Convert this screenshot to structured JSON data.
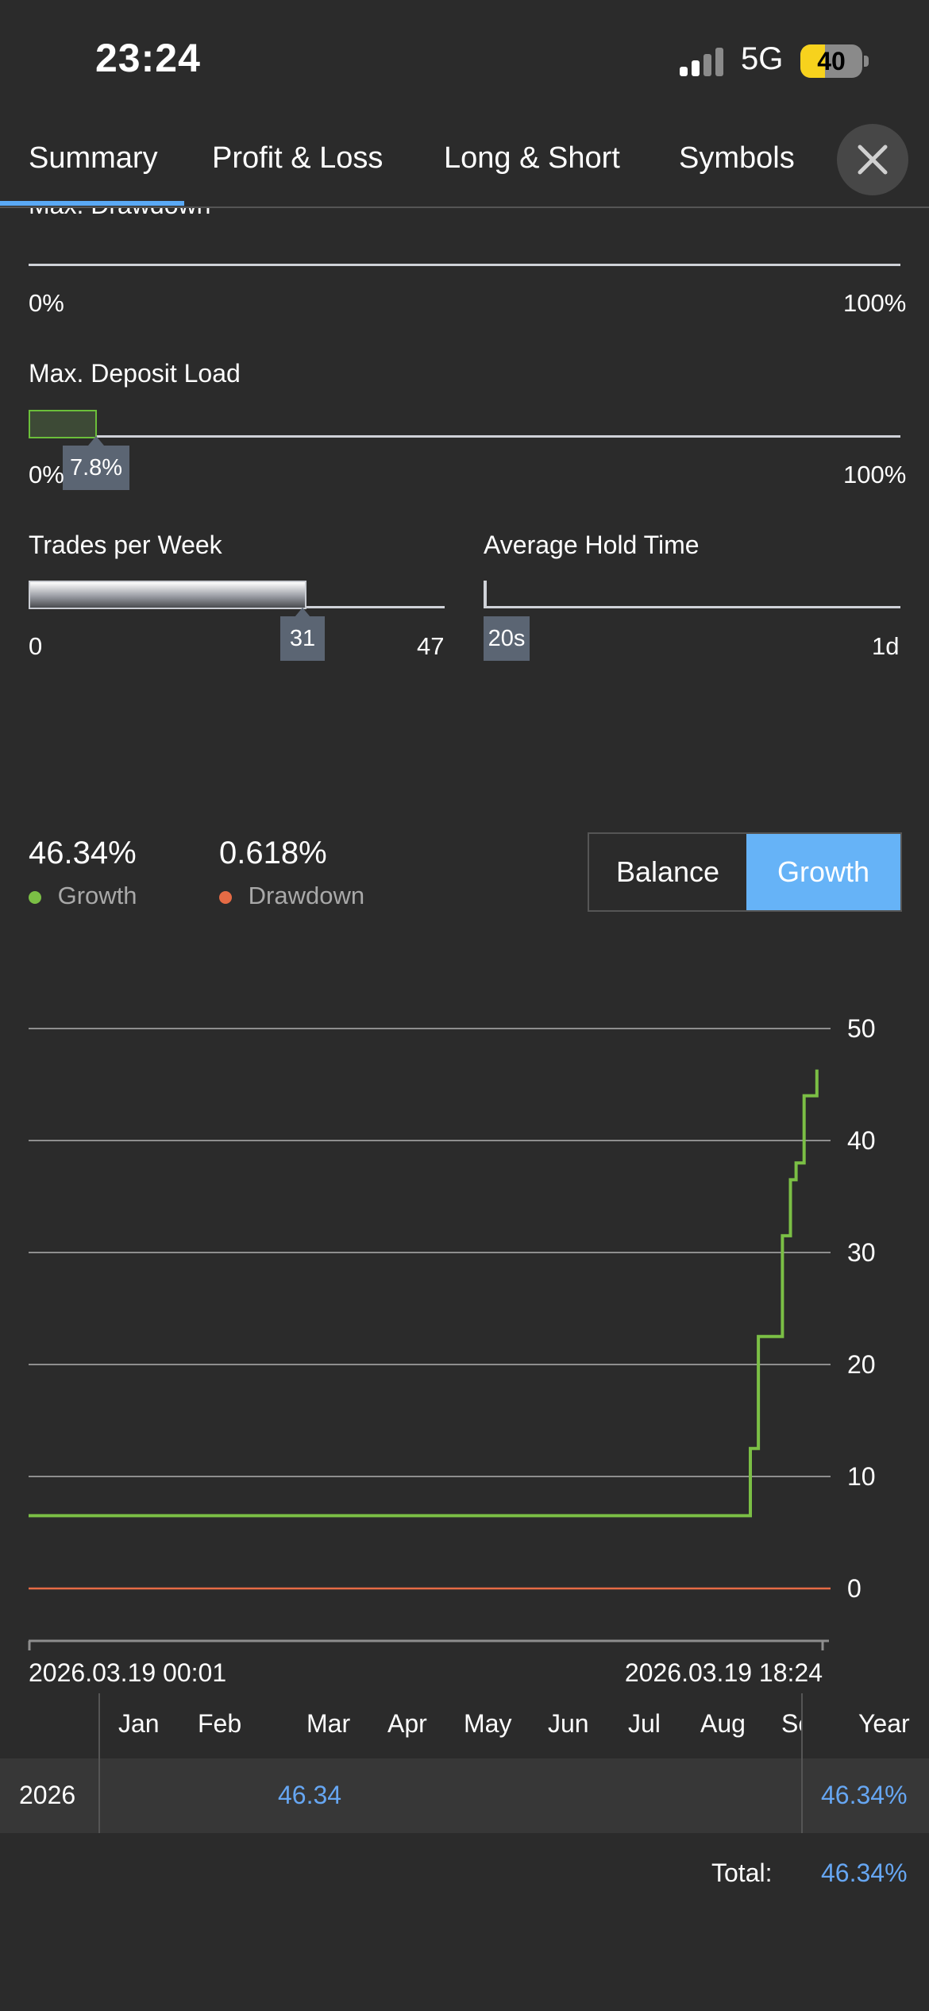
{
  "status": {
    "time": "23:24",
    "network": "5G",
    "battery": "40",
    "battery_level_percent": 40
  },
  "tabs": [
    {
      "label": "Summary",
      "active": true
    },
    {
      "label": "Profit & Loss"
    },
    {
      "label": "Long & Short"
    },
    {
      "label": "Symbols"
    }
  ],
  "drawdown": {
    "label_partial": "Max. Drawdown",
    "min": "0%",
    "max": "100%"
  },
  "deposit_load": {
    "label": "Max. Deposit Load",
    "value_label": "7.8%",
    "value_percent": 7.8,
    "min": "0%",
    "max": "100%"
  },
  "trades_per_week": {
    "label": "Trades per Week",
    "value": "31",
    "min": "0",
    "max": "47"
  },
  "hold_time": {
    "label": "Average Hold Time",
    "value": "20s",
    "min": "20s",
    "max": "1d"
  },
  "summary": {
    "growth_value": "46.34%",
    "growth_label": "Growth",
    "drawdown_value": "0.618%",
    "drawdown_label": "Drawdown",
    "toggle": {
      "balance": "Balance",
      "growth": "Growth",
      "selected": "Growth"
    }
  },
  "colors": {
    "accent": "#66a6f2",
    "growth": "#7bbf45",
    "drawdown": "#e56b45",
    "background": "#2b2b2b"
  },
  "chart_data": {
    "type": "line",
    "y_ticks": [
      "50",
      "40",
      "30",
      "20",
      "10",
      "0"
    ],
    "ylim": [
      0,
      50
    ],
    "x_labels": [
      "2026.03.19 00:01",
      "2026.03.19 18:24"
    ],
    "series": [
      {
        "name": "Growth",
        "color": "#7bbf45",
        "points": [
          [
            0,
            6.5
          ],
          [
            0.9,
            6.5
          ],
          [
            0.9,
            12.5
          ],
          [
            0.91,
            12.5
          ],
          [
            0.91,
            22.5
          ],
          [
            0.94,
            22.5
          ],
          [
            0.94,
            31.5
          ],
          [
            0.95,
            31.5
          ],
          [
            0.95,
            36.5
          ],
          [
            0.957,
            36.5
          ],
          [
            0.957,
            38
          ],
          [
            0.967,
            38
          ],
          [
            0.967,
            44
          ],
          [
            0.983,
            44
          ],
          [
            0.983,
            46.34
          ]
        ]
      },
      {
        "name": "Drawdown",
        "color": "#e56b45",
        "points": [
          [
            0,
            0
          ],
          [
            1,
            0
          ]
        ]
      }
    ]
  },
  "monthly_table": {
    "months": [
      "Jan",
      "Feb",
      "Mar",
      "Apr",
      "May",
      "Jun",
      "Jul",
      "Aug",
      "Se"
    ],
    "year_header": "Year",
    "rows": [
      {
        "year": "2026",
        "mar": "46.34",
        "total": "46.34%"
      }
    ],
    "total_label": "Total:",
    "total_value": "46.34%"
  }
}
